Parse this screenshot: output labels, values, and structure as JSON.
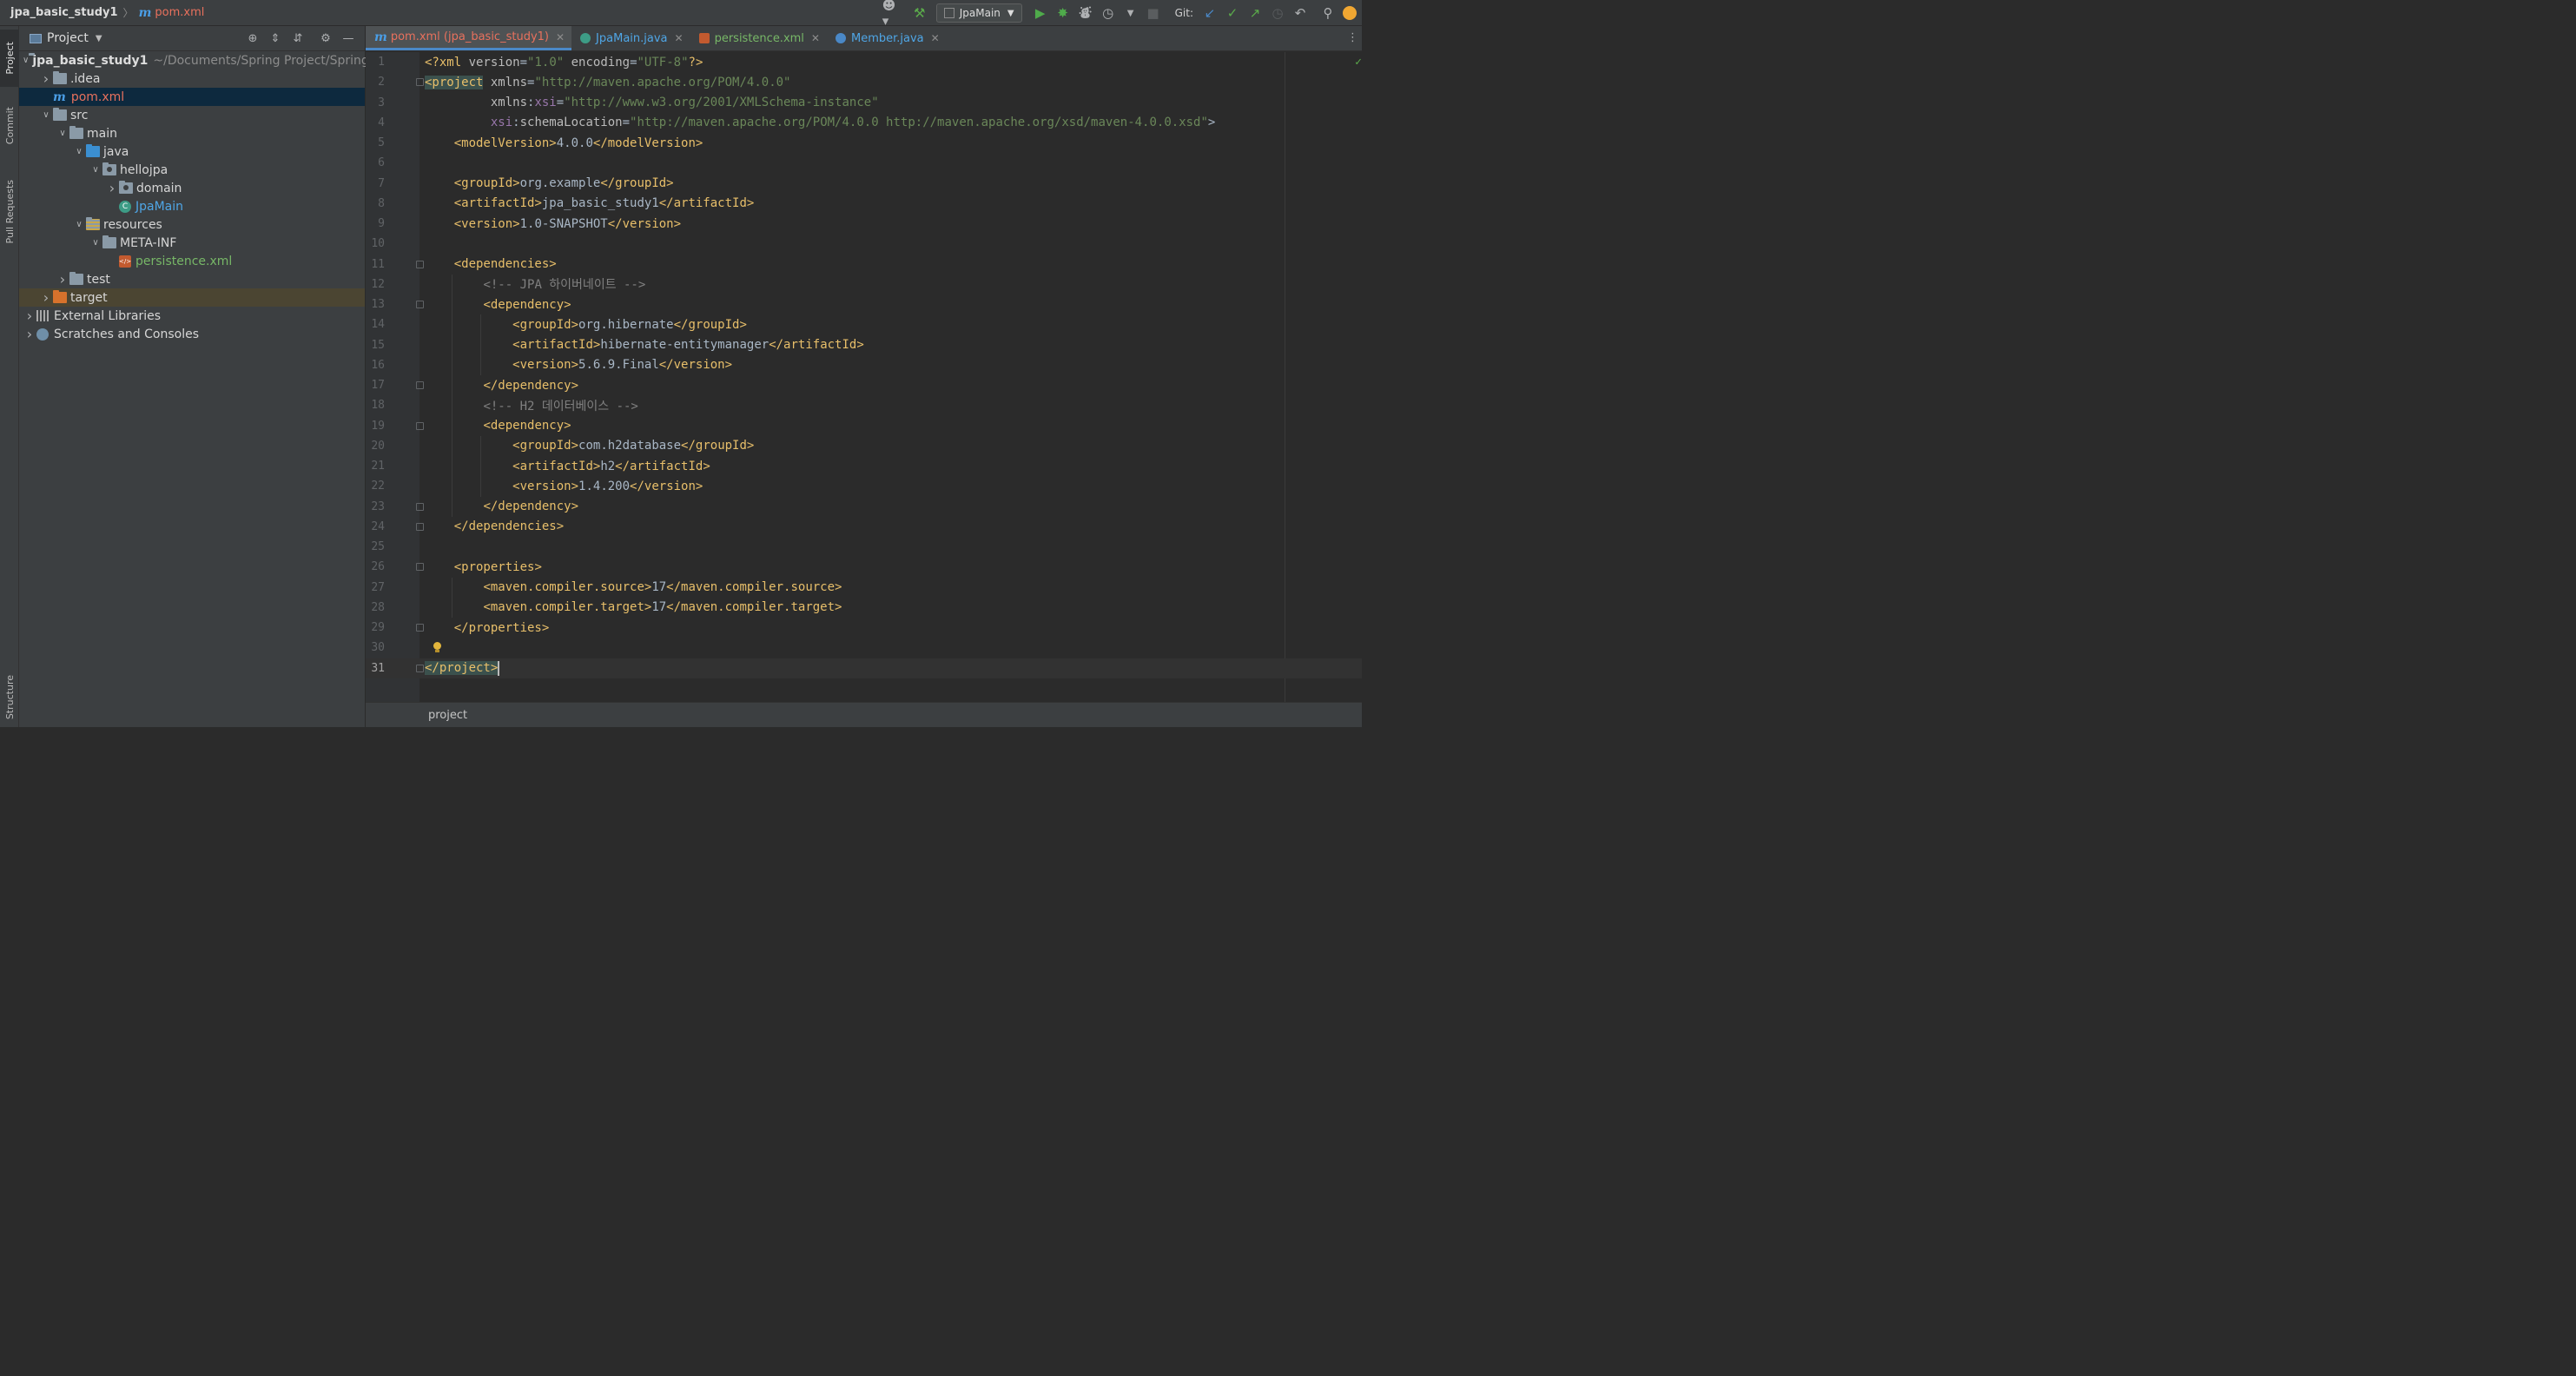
{
  "nav": {
    "project": "jpa_basic_study1",
    "file": "pom.xml"
  },
  "toolbar": {
    "run_config": "JpaMain",
    "git_label": "Git:"
  },
  "left_strip": [
    "Project",
    "Commit",
    "Pull Requests",
    "Structure"
  ],
  "panel": {
    "title": "Project"
  },
  "tree": [
    {
      "label": "jpa_basic_study1",
      "path": "~/Documents/Spring Project/Spring",
      "style": "bold",
      "icon": "folder",
      "indent": 0,
      "chevron": "down"
    },
    {
      "label": ".idea",
      "style": "normal",
      "icon": "folder",
      "indent": 1,
      "chevron": "right"
    },
    {
      "label": "pom.xml",
      "style": "red",
      "icon": "maven",
      "indent": 1,
      "chevron": "",
      "selected": true
    },
    {
      "label": "src",
      "style": "normal",
      "icon": "folder",
      "indent": 1,
      "chevron": "down"
    },
    {
      "label": "main",
      "style": "normal",
      "icon": "folder",
      "indent": 2,
      "chevron": "down"
    },
    {
      "label": "java",
      "style": "normal",
      "icon": "folder-blue",
      "indent": 3,
      "chevron": "down"
    },
    {
      "label": "hellojpa",
      "style": "normal",
      "icon": "package",
      "indent": 4,
      "chevron": "down"
    },
    {
      "label": "domain",
      "style": "normal",
      "icon": "package",
      "indent": 5,
      "chevron": "right"
    },
    {
      "label": "JpaMain",
      "style": "blue",
      "icon": "class",
      "indent": 5,
      "chevron": ""
    },
    {
      "label": "resources",
      "style": "normal",
      "icon": "folder-res",
      "indent": 3,
      "chevron": "down"
    },
    {
      "label": "META-INF",
      "style": "normal",
      "icon": "folder",
      "indent": 4,
      "chevron": "down"
    },
    {
      "label": "persistence.xml",
      "style": "green",
      "icon": "xml",
      "indent": 5,
      "chevron": ""
    },
    {
      "label": "test",
      "style": "normal",
      "icon": "folder",
      "indent": 2,
      "chevron": "right"
    },
    {
      "label": "target",
      "style": "normal",
      "icon": "folder-orange",
      "indent": 1,
      "chevron": "right",
      "excluded": true
    },
    {
      "label": "External Libraries",
      "style": "normal",
      "icon": "library",
      "indent": 0,
      "chevron": "right"
    },
    {
      "label": "Scratches and Consoles",
      "style": "normal",
      "icon": "scratch",
      "indent": 0,
      "chevron": "right"
    }
  ],
  "tabs": [
    {
      "label": "pom.xml (jpa_basic_study1)",
      "kind": "maven",
      "active": true
    },
    {
      "label": "JpaMain.java",
      "kind": "class",
      "active": false
    },
    {
      "label": "persistence.xml",
      "kind": "xml",
      "active": false
    },
    {
      "label": "Member.java",
      "kind": "class-blue",
      "active": false
    }
  ],
  "code": [
    "<?xml version=\"1.0\" encoding=\"UTF-8\"?>",
    "<project xmlns=\"http://maven.apache.org/POM/4.0.0\"",
    "         xmlns:xsi=\"http://www.w3.org/2001/XMLSchema-instance\"",
    "         xsi:schemaLocation=\"http://maven.apache.org/POM/4.0.0 http://maven.apache.org/xsd/maven-4.0.0.xsd\">",
    "    <modelVersion>4.0.0</modelVersion>",
    "",
    "    <groupId>org.example</groupId>",
    "    <artifactId>jpa_basic_study1</artifactId>",
    "    <version>1.0-SNAPSHOT</version>",
    "",
    "    <dependencies>",
    "        <!-- JPA 하이버네이트 -->",
    "        <dependency>",
    "            <groupId>org.hibernate</groupId>",
    "            <artifactId>hibernate-entitymanager</artifactId>",
    "            <version>5.6.9.Final</version>",
    "        </dependency>",
    "        <!-- H2 데이터베이스 -->",
    "        <dependency>",
    "            <groupId>com.h2database</groupId>",
    "            <artifactId>h2</artifactId>",
    "            <version>1.4.200</version>",
    "        </dependency>",
    "    </dependencies>",
    "",
    "    <properties>",
    "        <maven.compiler.source>17</maven.compiler.source>",
    "        <maven.compiler.target>17</maven.compiler.target>",
    "    </properties>",
    "",
    "</project>"
  ],
  "fold_lines": [
    2,
    11,
    13,
    17,
    19,
    23,
    24,
    26,
    29,
    31
  ],
  "current_line": 31,
  "bulb_line": 30,
  "status": {
    "breadcrumb": "project"
  },
  "colors": {
    "tag": "#e8bf6a",
    "attr": "#bababa",
    "ns": "#9876aa",
    "value": "#6a8759",
    "comment": "#808080",
    "accent": "#4a88c7"
  }
}
